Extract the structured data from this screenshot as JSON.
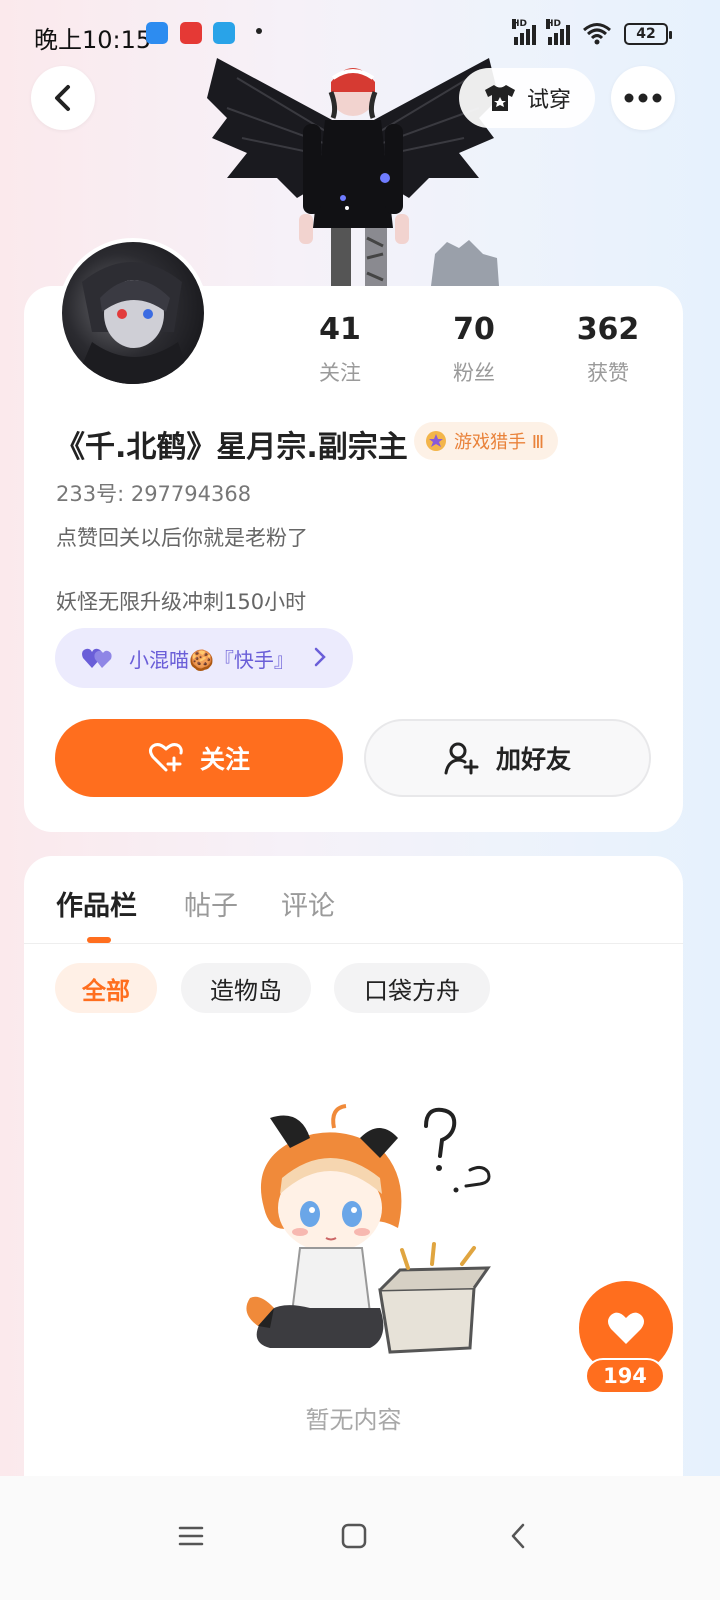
{
  "status_bar": {
    "time": "晚上10:15",
    "battery": "42",
    "signal_label_1": "HD",
    "signal_label_2": "HD"
  },
  "header": {
    "try_on_label": "试穿",
    "back_icon": "back-icon",
    "more_icon": "more-icon"
  },
  "profile": {
    "stats": [
      {
        "value": "41",
        "label": "关注"
      },
      {
        "value": "70",
        "label": "粉丝"
      },
      {
        "value": "362",
        "label": "获赞"
      }
    ],
    "nickname": "《千.北鹤》星月宗.副宗主",
    "badge_label": "游戏猎手 Ⅲ",
    "uid": "233号: 297794368",
    "bio_line1": "点赞回关以后你就是老粉了",
    "bio_line2": "妖怪无限升级冲刺150小时",
    "guild_label": "小混喵🍪『快手』",
    "follow_button": "关注",
    "add_friend_button": "加好友"
  },
  "content": {
    "tabs": [
      {
        "label": "作品栏",
        "active": true
      },
      {
        "label": "帖子",
        "active": false
      },
      {
        "label": "评论",
        "active": false
      }
    ],
    "filters": [
      {
        "label": "全部",
        "active": true
      },
      {
        "label": "造物岛",
        "active": false
      },
      {
        "label": "口袋方舟",
        "active": false
      }
    ],
    "empty_text": "暂无内容"
  },
  "floating_like": {
    "count": "194"
  },
  "colors": {
    "accent": "#ff6e1e",
    "guild": "#6a5ed8",
    "badge": "#e9823a"
  }
}
